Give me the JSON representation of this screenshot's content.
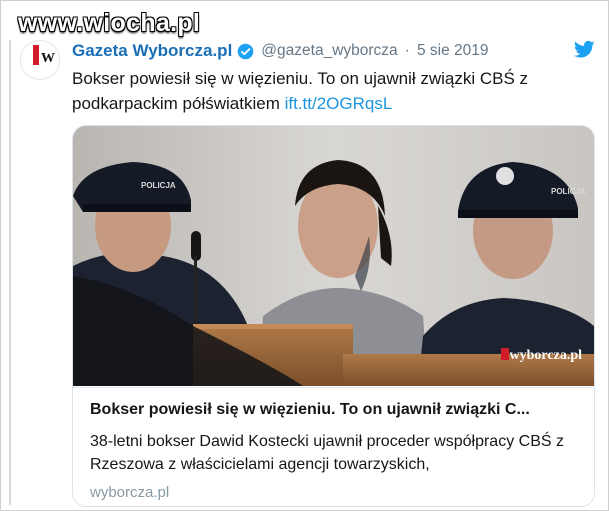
{
  "watermark": "www.wiocha.pl",
  "tweet": {
    "display_name": "Gazeta Wyborcza.pl",
    "handle": "@gazeta_wyborcza",
    "separator": "·",
    "date": "5 sie 2019",
    "text_line1": "Bokser powiesił się w więzieniu. To on ujawnił związki CBŚ z",
    "text_line2": "podkarpackim półświatkiem",
    "link": "ift.tt/2OGRqsL"
  },
  "card": {
    "image_logo": "wyborcza.pl",
    "title": "Bokser powiesił się w więzieniu. To on ujawnił związki C...",
    "description": "38-letni bokser Dawid Kostecki ujawnił proceder współpracy CBŚ z Rzeszowa z właścicielami agencji towarzyskich,",
    "domain": "wyborcza.pl",
    "police_cap_text": "POLICJA"
  },
  "icons": {
    "verified": "verified-badge-icon",
    "bird": "twitter-bird-icon"
  },
  "colors": {
    "name": "#1b6fb6",
    "link": "#1b95e0",
    "muted": "#657786"
  }
}
